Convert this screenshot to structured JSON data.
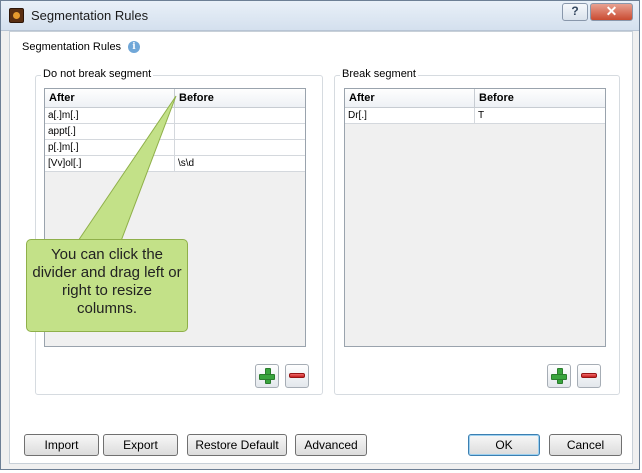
{
  "window": {
    "title": "Segmentation Rules",
    "help_label": "?",
    "close_label": "✕"
  },
  "header": {
    "label": "Segmentation Rules",
    "info_symbol": "i"
  },
  "do_not_break": {
    "label": "Do not break segment",
    "columns": [
      "After",
      "Before"
    ],
    "rows": [
      {
        "after": "a[.]m[.]",
        "before": ""
      },
      {
        "after": "appt[.]",
        "before": ""
      },
      {
        "after": "p[.]m[.]",
        "before": ""
      },
      {
        "after": "[Vv]ol[.]",
        "before": "\\s\\d"
      }
    ]
  },
  "break_segment": {
    "label": "Break segment",
    "columns": [
      "After",
      "Before"
    ],
    "rows": [
      {
        "after": "Dr[.]",
        "before": "T"
      }
    ]
  },
  "callout": {
    "text": "You can click the divider and drag left or right to resize columns."
  },
  "buttons": {
    "import": "Import",
    "export": "Export",
    "restore_default": "Restore Default",
    "advanced": "Advanced",
    "ok": "OK",
    "cancel": "Cancel"
  },
  "icons": {
    "add": "plus-icon",
    "remove": "minus-icon"
  },
  "colors": {
    "callout_fill": "#c3e188",
    "add_green": "#39a43d",
    "remove_red": "#c51f1f",
    "close_red": "#c94b31"
  }
}
